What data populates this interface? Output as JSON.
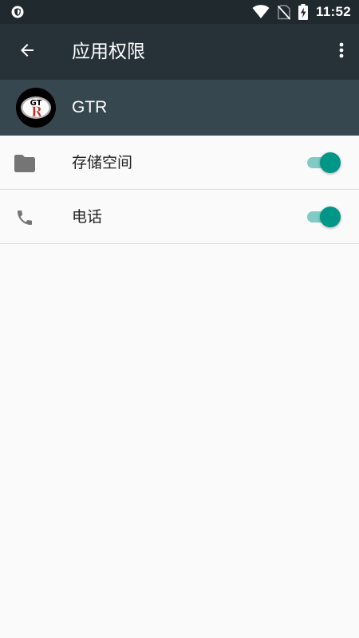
{
  "status_bar": {
    "time": "11:52",
    "icons": [
      "shield-icon",
      "wifi-icon",
      "no-sim-icon",
      "battery-charging-icon"
    ]
  },
  "app_bar": {
    "title": "应用权限",
    "back_icon": "arrow-back-icon",
    "more_icon": "more-vert-icon"
  },
  "app": {
    "name": "GTR",
    "logo_text": "GTR"
  },
  "permissions": [
    {
      "label": "存储空间",
      "icon": "folder-icon",
      "enabled": true
    },
    {
      "label": "电话",
      "icon": "phone-icon",
      "enabled": true
    }
  ],
  "colors": {
    "status_bar": "#1f292e",
    "app_bar": "#263238",
    "app_header": "#37474f",
    "background": "#fafafa",
    "toggle_thumb": "#009688",
    "toggle_track": "#80cbc4",
    "icon_grey": "#757575"
  }
}
